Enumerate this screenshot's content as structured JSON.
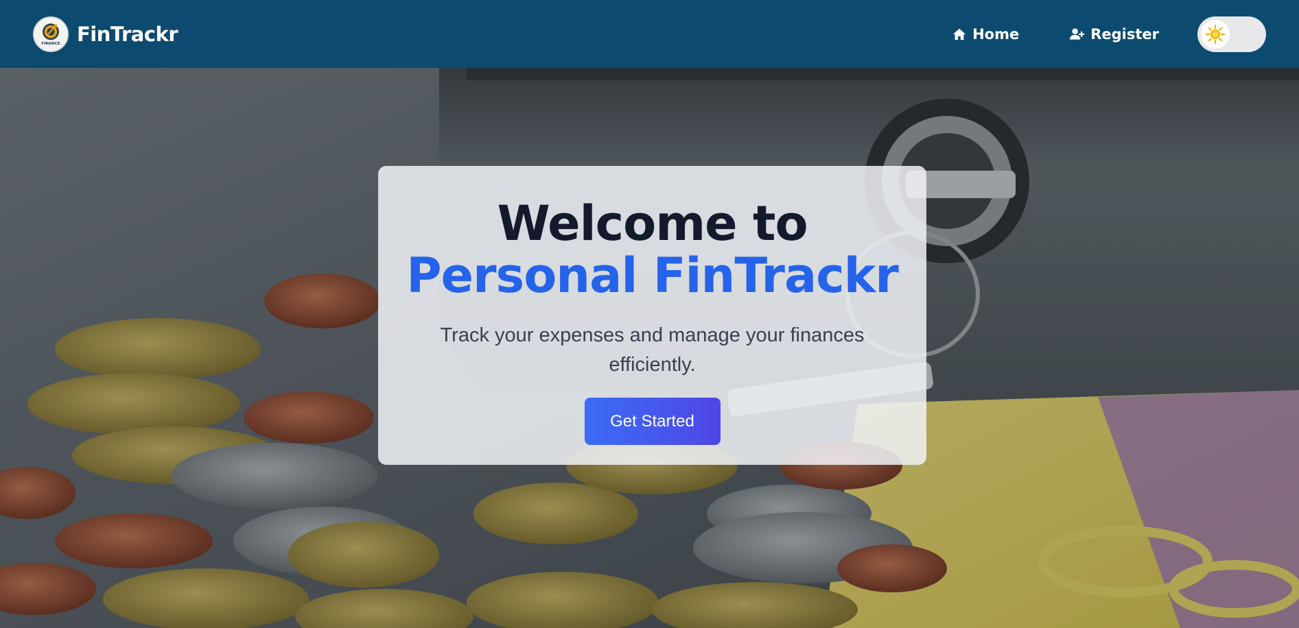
{
  "app": {
    "brand_name": "FinTrackr",
    "logo_text": "FINANCE"
  },
  "nav": {
    "home_label": "Home",
    "register_label": "Register",
    "theme_toggle": {
      "mode": "light",
      "icon": "sun-icon"
    }
  },
  "hero": {
    "title_line1": "Welcome to",
    "title_line2": "Personal FinTrackr",
    "subtitle": "Track your expenses and manage your finances efficiently.",
    "cta_label": "Get Started"
  },
  "colors": {
    "navbar": "#0d4a6f",
    "accent": "#2563eb",
    "button_start": "#3b6cf6",
    "button_end": "#4f46e5",
    "title": "#131a2c"
  }
}
